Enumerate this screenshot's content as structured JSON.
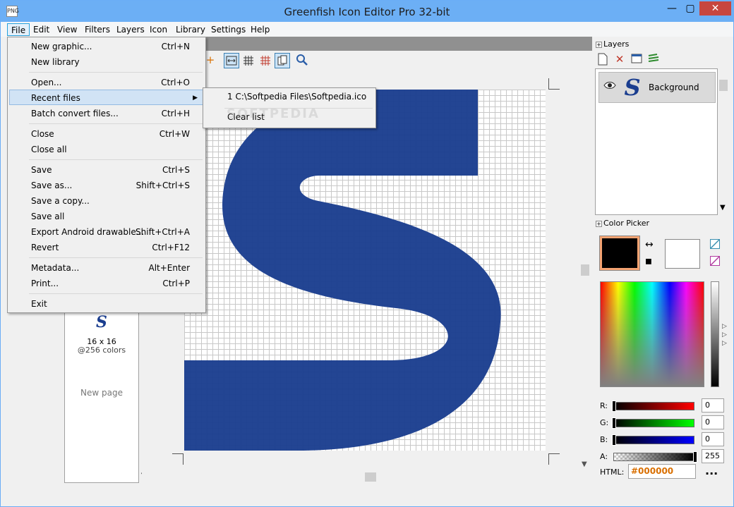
{
  "window": {
    "title": "Greenfish Icon Editor Pro 32-bit",
    "app_icon": "PNG",
    "minimize": "—",
    "maximize": "▢",
    "close": "✕"
  },
  "menubar": [
    "File",
    "Edit",
    "View",
    "Filters",
    "Layers",
    "Icon",
    "Library",
    "Settings",
    "Help"
  ],
  "file_menu": {
    "items": [
      {
        "label": "New graphic...",
        "shortcut": "Ctrl+N"
      },
      {
        "label": "New library",
        "shortcut": ""
      },
      {
        "label": "Open...",
        "shortcut": "Ctrl+O"
      },
      {
        "label": "Recent files",
        "shortcut": ""
      },
      {
        "label": "Batch convert files...",
        "shortcut": "Ctrl+H"
      },
      {
        "label": "Close",
        "shortcut": "Ctrl+W"
      },
      {
        "label": "Close all",
        "shortcut": ""
      },
      {
        "label": "Save",
        "shortcut": "Ctrl+S"
      },
      {
        "label": "Save as...",
        "shortcut": "Shift+Ctrl+S"
      },
      {
        "label": "Save a copy...",
        "shortcut": ""
      },
      {
        "label": "Save all",
        "shortcut": ""
      },
      {
        "label": "Export Android drawable...",
        "shortcut": "Shift+Ctrl+A"
      },
      {
        "label": "Revert",
        "shortcut": "Ctrl+F12"
      },
      {
        "label": "Metadata...",
        "shortcut": "Alt+Enter"
      },
      {
        "label": "Print...",
        "shortcut": "Ctrl+P"
      },
      {
        "label": "Exit",
        "shortcut": ""
      }
    ],
    "submenu_arrow": "▶"
  },
  "recent_submenu": {
    "file1": "1 C:\\Softpedia Files\\Softpedia.ico",
    "clear": "Clear list"
  },
  "watermark": "SOFTPEDIA",
  "pages": {
    "thumb_letter": "S",
    "size": "16 x 16",
    "colors": "@256 colors",
    "new_page": "New page"
  },
  "layers": {
    "title": "Layers",
    "expander": "+",
    "layer_name": "Background",
    "thumb_letter": "S"
  },
  "color_picker": {
    "title": "Color Picker",
    "expander": "+",
    "primary": "#000000",
    "secondary": "#ffffff",
    "r_label": "R:",
    "g_label": "G:",
    "b_label": "B:",
    "a_label": "A:",
    "r_value": "0",
    "g_value": "0",
    "b_value": "0",
    "a_value": "255",
    "html_label": "HTML:",
    "html_value": "#000000",
    "more": "..."
  },
  "icons": {
    "swap": "↔",
    "reset": "◼",
    "eye": "👁",
    "zoom": "🔍",
    "plus": "+",
    "new_layer": "📄",
    "delete_layer": "✕",
    "layer_props": "▤",
    "merge": "≋",
    "scroll_down": "▼"
  },
  "colors": {
    "icon_blue": "#1a3d8f",
    "accent": "#d96f00",
    "title_bar": "#6caff5"
  }
}
